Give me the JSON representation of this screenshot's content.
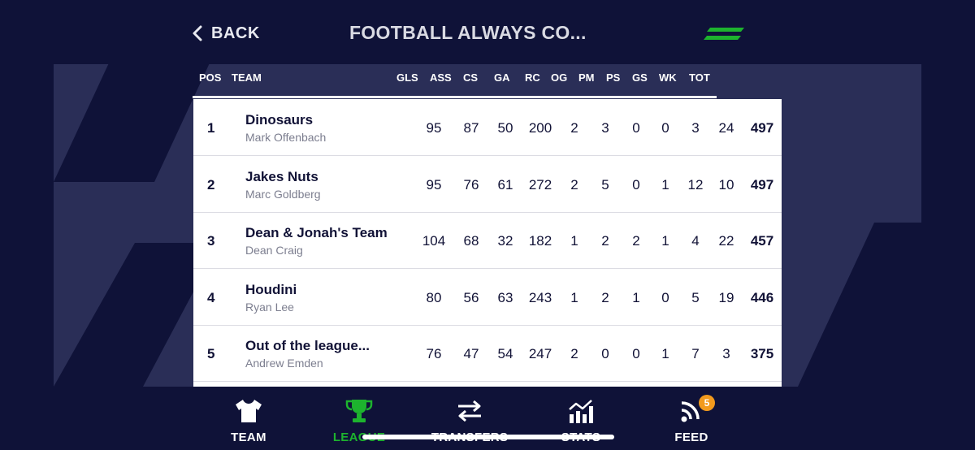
{
  "header": {
    "back_label": "BACK",
    "title": "FOOTBALL ALWAYS CO...",
    "accent_color": "#1db32e"
  },
  "columns": [
    "POS",
    "TEAM",
    "GLS",
    "ASS",
    "CS",
    "GA",
    "RC",
    "OG",
    "PM",
    "PS",
    "GS",
    "WK",
    "TOT"
  ],
  "standings": [
    {
      "pos": "1",
      "team": "Dinosaurs",
      "manager": "Mark Offenbach",
      "stats": [
        "95",
        "87",
        "50",
        "200",
        "2",
        "3",
        "0",
        "0",
        "3",
        "24"
      ],
      "total": "497"
    },
    {
      "pos": "2",
      "team": "Jakes Nuts",
      "manager": "Marc Goldberg",
      "stats": [
        "95",
        "76",
        "61",
        "272",
        "2",
        "5",
        "0",
        "1",
        "12",
        "10"
      ],
      "total": "497"
    },
    {
      "pos": "3",
      "team": "Dean & Jonah's Team",
      "manager": "Dean Craig",
      "stats": [
        "104",
        "68",
        "32",
        "182",
        "1",
        "2",
        "2",
        "1",
        "4",
        "22"
      ],
      "total": "457"
    },
    {
      "pos": "4",
      "team": "Houdini",
      "manager": "Ryan Lee",
      "stats": [
        "80",
        "56",
        "63",
        "243",
        "1",
        "2",
        "1",
        "0",
        "5",
        "19"
      ],
      "total": "446"
    },
    {
      "pos": "5",
      "team": "Out of the league...",
      "manager": "Andrew Emden",
      "stats": [
        "76",
        "47",
        "54",
        "247",
        "2",
        "0",
        "0",
        "1",
        "7",
        "3"
      ],
      "total": "375"
    }
  ],
  "nav": {
    "items": [
      {
        "label": "TEAM",
        "icon": "shirt-icon"
      },
      {
        "label": "LEAGUE",
        "icon": "trophy-icon",
        "active": true
      },
      {
        "label": "TRANSFERS",
        "icon": "transfer-arrows-icon"
      },
      {
        "label": "STATS",
        "icon": "stats-chart-icon"
      },
      {
        "label": "FEED",
        "icon": "rss-feed-icon",
        "badge": "5"
      }
    ]
  }
}
